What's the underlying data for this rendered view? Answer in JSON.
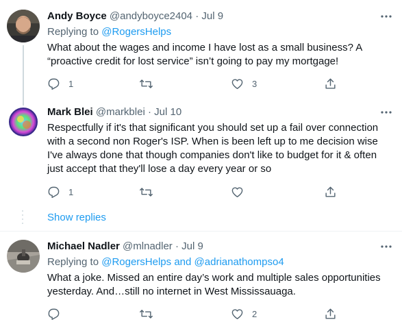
{
  "tweets": [
    {
      "name": "Andy Boyce",
      "handle": "@andyboyce2404",
      "separator": "·",
      "date": "Jul 9",
      "replying_prefix": "Replying to",
      "replying_to": [
        "@RogersHelps"
      ],
      "text": "What about the wages and income I have lost as a small business?  A “proactive credit for lost service” isn’t going to pay my mortgage!",
      "replies": "1",
      "retweets": "",
      "likes": "3"
    },
    {
      "name": "Mark Blei",
      "handle": "@markblei",
      "separator": "·",
      "date": "Jul 10",
      "text": "Respectfully if it's that significant you should set up a fail over connection with a second non Roger's ISP. When is been left up to me decision wise I've always done that though companies don't like to budget for it & often just accept that they'll lose a day every year or so",
      "replies": "1",
      "retweets": "",
      "likes": ""
    },
    {
      "name": "Michael Nadler",
      "handle": "@mlnadler",
      "separator": "·",
      "date": "Jul 9",
      "replying_prefix": "Replying to",
      "replying_to": [
        "@RogersHelps",
        "@adrianathompso4"
      ],
      "replying_joiner": "and",
      "text": "What a joke. Missed an entire day’s work and multiple sales opportunities yesterday. And…still no internet in West Mississauaga.",
      "replies": "",
      "retweets": "",
      "likes": "2"
    }
  ],
  "show_replies_label": "Show replies",
  "icons": {
    "reply": "reply-icon",
    "retweet": "retweet-icon",
    "like": "heart-icon",
    "share": "share-icon",
    "more": "more-icon"
  },
  "colors": {
    "text": "#0f1419",
    "muted": "#536471",
    "link": "#1d9bf0",
    "line": "#cfd9de",
    "divider": "#eff3f4"
  }
}
